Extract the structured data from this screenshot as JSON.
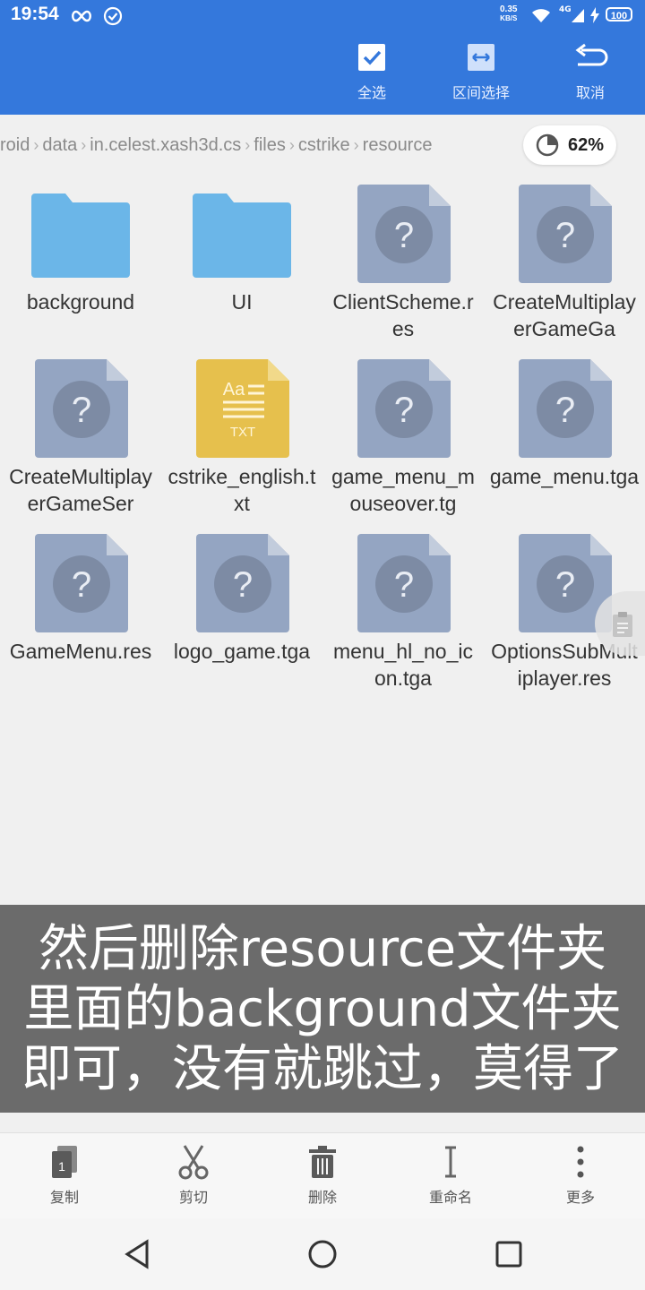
{
  "status_bar": {
    "time": "19:54",
    "net_speed_value": "0.35",
    "net_speed_unit": "KB/S",
    "network": "4G",
    "battery": "100"
  },
  "top_actions": [
    {
      "label": "全选",
      "icon": "check-square-icon"
    },
    {
      "label": "区间选择",
      "icon": "range-select-icon"
    },
    {
      "label": "取消",
      "icon": "undo-arrow-icon"
    }
  ],
  "breadcrumb": [
    "roid",
    "data",
    "in.celest.xash3d.cs",
    "files",
    "cstrike",
    "resource"
  ],
  "storage": {
    "percent": "62%",
    "icon": "pie-chart-icon"
  },
  "files": [
    {
      "name": "background",
      "type": "folder"
    },
    {
      "name": "UI",
      "type": "folder"
    },
    {
      "name": "ClientScheme.res",
      "type": "unknown"
    },
    {
      "name": "CreateMultiplayerGameGa",
      "type": "unknown"
    },
    {
      "name": "CreateMultiplayerGameSer",
      "type": "unknown"
    },
    {
      "name": "cstrike_english.txt",
      "type": "txt"
    },
    {
      "name": "game_menu_mouseover.tg",
      "type": "unknown"
    },
    {
      "name": "game_menu.tga",
      "type": "unknown"
    },
    {
      "name": "GameMenu.res",
      "type": "unknown"
    },
    {
      "name": "logo_game.tga",
      "type": "unknown"
    },
    {
      "name": "menu_hl_no_icon.tga",
      "type": "unknown"
    },
    {
      "name": "OptionsSubMultiplayer.res",
      "type": "unknown"
    }
  ],
  "txt_icon": {
    "top": "Aa",
    "bottom": "TXT"
  },
  "caption": {
    "line1": "然后删除resource文件夹",
    "line2": "里面的background文件夹",
    "line3": "即可，没有就跳过，莫得了"
  },
  "bottom_toolbar": [
    {
      "label": "复制",
      "icon": "copy-icon"
    },
    {
      "label": "剪切",
      "icon": "scissors-icon"
    },
    {
      "label": "删除",
      "icon": "trash-icon"
    },
    {
      "label": "重命名",
      "icon": "rename-icon"
    },
    {
      "label": "更多",
      "icon": "more-vertical-icon"
    }
  ],
  "colors": {
    "top_bar": "#3478dc",
    "folder": "#6bb6e8",
    "unknown_file": "#94a5c2",
    "txt_file": "#e6c04d",
    "caption_bg": "#6b6b6b"
  }
}
